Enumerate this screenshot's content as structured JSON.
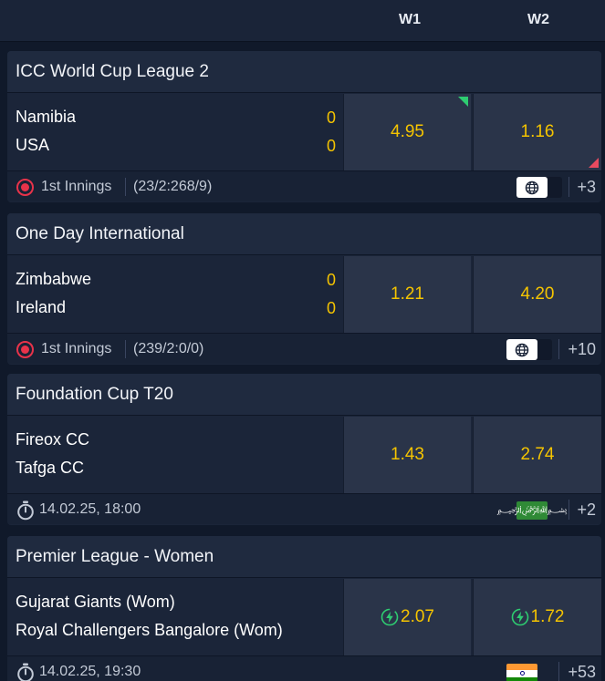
{
  "header": {
    "w1_label": "W1",
    "w2_label": "W2"
  },
  "colors": {
    "accent_odds": "#f5c400",
    "live": "#e8334a",
    "up": "#2ecc71",
    "down": "#e84a5f"
  },
  "events": [
    {
      "league": "ICC World Cup League 2",
      "team1": "Namibia",
      "team2": "USA",
      "score1": "0",
      "score2": "0",
      "w1": "4.95",
      "w2": "1.16",
      "status": "live",
      "stage": "1st Innings",
      "detail": "(23/2:268/9)",
      "stream_icon": "globe-icon",
      "more": "+3"
    },
    {
      "league": "One Day International",
      "team1": "Zimbabwe",
      "team2": "Ireland",
      "score1": "0",
      "score2": "0",
      "w1": "1.21",
      "w2": "4.20",
      "status": "live",
      "stage": "1st Innings",
      "detail": "(239/2:0/0)",
      "stream_icon": "globe-icon",
      "more": "+10"
    },
    {
      "league": "Foundation Cup T20",
      "team1": "Fireox CC",
      "team2": "Tafga CC",
      "w1": "1.43",
      "w2": "2.74",
      "status": "scheduled",
      "datetime": "14.02.25, 18:00",
      "flag_icon": "saudi-flag-icon",
      "more": "+2"
    },
    {
      "league": "Premier League - Women",
      "team1": "Gujarat Giants (Wom)",
      "team2": "Royal Challengers Bangalore (Wom)",
      "w1": "2.07",
      "w2": "1.72",
      "status": "scheduled",
      "datetime": "14.02.25, 19:30",
      "flag_icon": "india-flag-icon",
      "more": "+53"
    }
  ]
}
